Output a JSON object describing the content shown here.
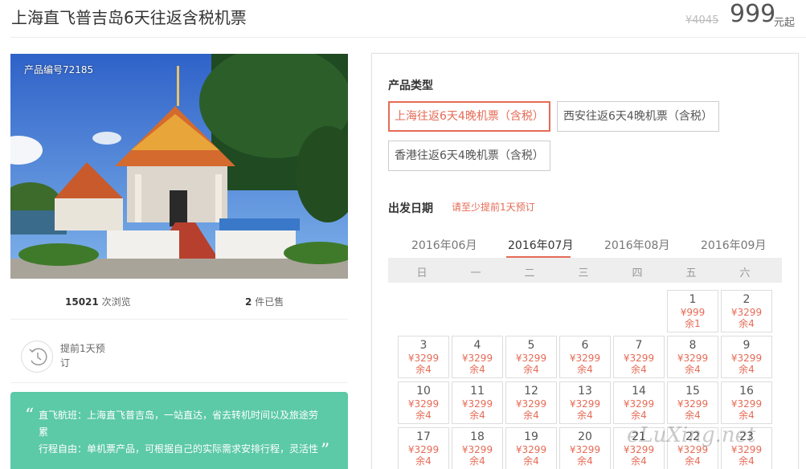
{
  "header": {
    "title": "上海直飞普吉岛6天往返含税机票",
    "old_price": "¥4045",
    "price": "999",
    "price_unit": "元起"
  },
  "gallery": {
    "product_no": "产品编号72185"
  },
  "stats": {
    "views_count": "15021",
    "views_label": "次浏览",
    "sold_count": "2",
    "sold_label": "件已售"
  },
  "booking": {
    "advance_text": "提前1天预订"
  },
  "note": {
    "line1": "直飞航班：上海直飞普吉岛，一站直达，省去转机时间以及旅途劳累",
    "line2": "行程自由：单机票产品，可根据自己的实际需求安排行程，灵活性"
  },
  "panel": {
    "type_label": "产品类型",
    "options": [
      "上海往返6天4晚机票（含税）",
      "西安往返6天4晚机票（含税）",
      "香港往返6天4晚机票（含税）"
    ],
    "selected_option": 0,
    "date_label": "出发日期",
    "date_hint": "请至少提前1天预订",
    "months": [
      "2016年06月",
      "2016年07月",
      "2016年08月",
      "2016年09月"
    ],
    "active_month": 1,
    "weekdays": [
      "日",
      "一",
      "二",
      "三",
      "四",
      "五",
      "六"
    ],
    "remain_prefix": "余"
  },
  "calendar": [
    {
      "day": "1",
      "price": "¥999",
      "remain": "1"
    },
    {
      "day": "2",
      "price": "¥3299",
      "remain": "4"
    },
    {
      "day": "3",
      "price": "¥3299",
      "remain": "4"
    },
    {
      "day": "4",
      "price": "¥3299",
      "remain": "4"
    },
    {
      "day": "5",
      "price": "¥3299",
      "remain": "4"
    },
    {
      "day": "6",
      "price": "¥3299",
      "remain": "4"
    },
    {
      "day": "7",
      "price": "¥3299",
      "remain": "4"
    },
    {
      "day": "8",
      "price": "¥3299",
      "remain": "4"
    },
    {
      "day": "9",
      "price": "¥3299",
      "remain": "4"
    },
    {
      "day": "10",
      "price": "¥3299",
      "remain": "4"
    },
    {
      "day": "11",
      "price": "¥3299",
      "remain": "4"
    },
    {
      "day": "12",
      "price": "¥3299",
      "remain": "4"
    },
    {
      "day": "13",
      "price": "¥3299",
      "remain": "4"
    },
    {
      "day": "14",
      "price": "¥3299",
      "remain": "4"
    },
    {
      "day": "15",
      "price": "¥3299",
      "remain": "4"
    },
    {
      "day": "16",
      "price": "¥3299",
      "remain": "4"
    },
    {
      "day": "17",
      "price": "¥3299",
      "remain": "4"
    },
    {
      "day": "18",
      "price": "¥3299",
      "remain": "4"
    },
    {
      "day": "19",
      "price": "¥3299",
      "remain": "4"
    },
    {
      "day": "20",
      "price": "¥3299",
      "remain": "4"
    },
    {
      "day": "21",
      "price": "¥3299",
      "remain": "4"
    },
    {
      "day": "22",
      "price": "¥3299",
      "remain": "4"
    },
    {
      "day": "23",
      "price": "¥3299",
      "remain": "4"
    }
  ],
  "watermark": "eLuXing.net",
  "colors": {
    "accent": "#e56b56",
    "note_bg": "#5cc9a7"
  }
}
